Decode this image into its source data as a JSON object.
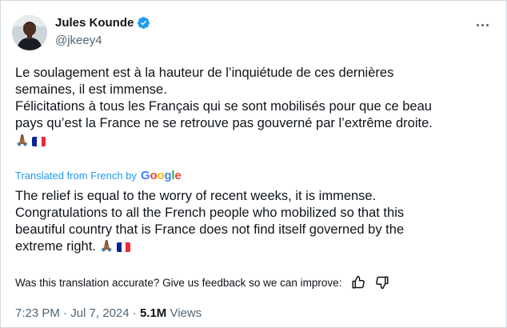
{
  "author": {
    "display_name": "Jules Kounde",
    "handle": "@jkeey4"
  },
  "original_text": {
    "line1": "Le soulagement est à la hauteur de l’inquiétude de ces dernières",
    "line2": "semaines, il est immense.",
    "line3": "Félicitations à tous les Français qui se sont mobilisés pour que ce beau",
    "line4": "pays qu’est la France ne se retrouve pas gouverné par l’extrême droite.",
    "emoji_pray": "🙏🏾"
  },
  "translation": {
    "label": "Translated from French by",
    "provider": "Google",
    "line1": "The relief is equal to the worry of recent weeks, it is immense.",
    "line2": "Congratulations to all the French people who mobilized so that this",
    "line3": "beautiful country that is France does not find itself governed by the",
    "line4": "extreme right.",
    "emoji_pray": "🙏🏾"
  },
  "feedback": {
    "question": "Was this translation accurate? Give us feedback so we can improve:"
  },
  "meta": {
    "time": "7:23 PM",
    "separator1": "·",
    "date": "Jul 7, 2024",
    "separator2": "·",
    "views_count": "5.1M",
    "views_label": "Views"
  },
  "colors": {
    "link_blue": "#1d9bf0",
    "secondary_text": "#536471",
    "flag_blue": "#002395",
    "flag_white": "#ffffff",
    "flag_red": "#ed2939"
  },
  "icons": {
    "verified": "verified-badge-icon",
    "more": "more-options-icon",
    "thumbs_up": "thumbs-up-icon",
    "thumbs_down": "thumbs-down-icon"
  }
}
